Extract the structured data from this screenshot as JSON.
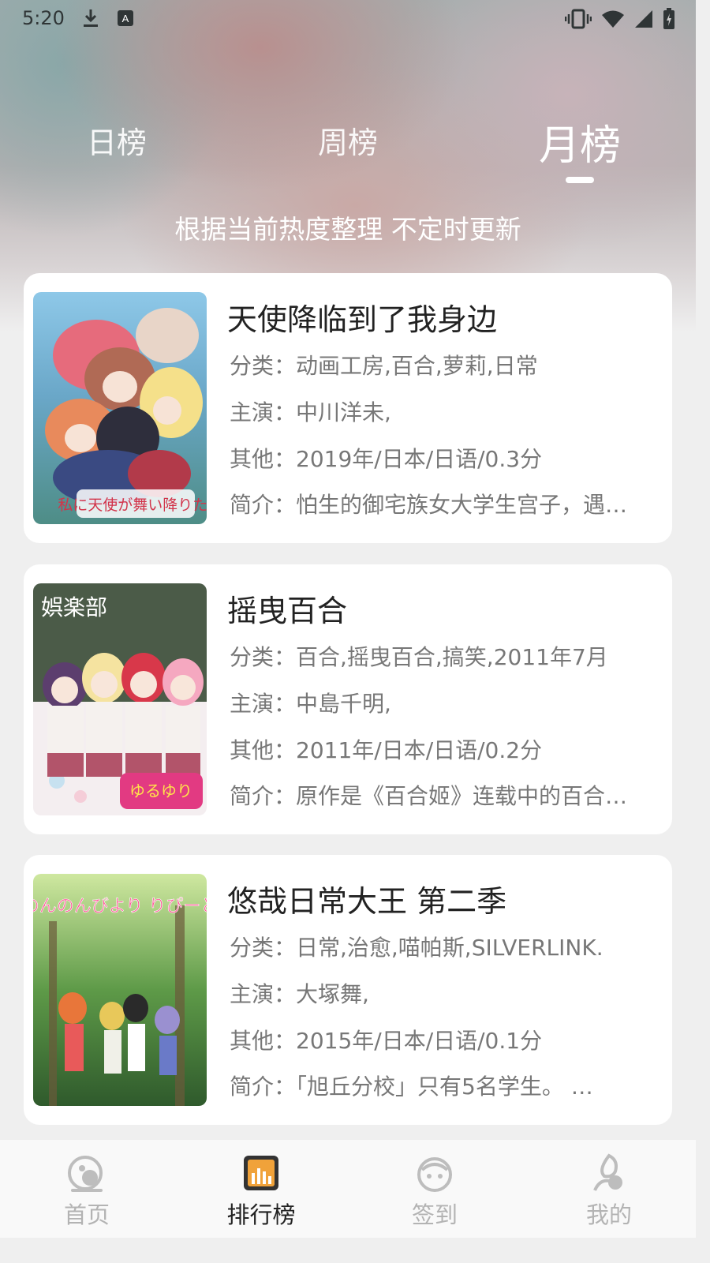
{
  "status_bar": {
    "time": "5:20",
    "icons": [
      "download-icon",
      "a-notification-icon",
      "vibrate-icon",
      "wifi-icon",
      "signal-icon",
      "battery-icon"
    ]
  },
  "tabs": {
    "daily": "日榜",
    "weekly": "周榜",
    "monthly": "月榜",
    "active": "monthly"
  },
  "subtitle": "根据当前热度整理 不定时更新",
  "items": [
    {
      "title": "天使降临到了我身边",
      "category": "分类：动画工房,百合,萝莉,日常",
      "cast": "主演：中川洋未,",
      "other": "其他：2019年/日本/日语/0.3分",
      "intro": "简介：怕生的御宅族女大学生宫子，遇…",
      "poster_text": "私に天使が舞い降りた!"
    },
    {
      "title": "摇曳百合",
      "category": "分类：百合,摇曳百合,搞笑,2011年7月",
      "cast": "主演：中島千明,",
      "other": "其他：2011年/日本/日语/0.2分",
      "intro": "简介：原作是《百合姬》连载中的百合…",
      "poster_text": "娯楽部"
    },
    {
      "title": "悠哉日常大王 第二季",
      "category": "分类：日常,治愈,喵帕斯,SILVERLINK.",
      "cast": "主演：大塚舞,",
      "other": "其他：2015年/日本/日语/0.1分",
      "intro": "简介：「旭丘分校」只有5名学生。 …",
      "poster_text": "のんのんびより りぴーと"
    }
  ],
  "bottom_nav": [
    {
      "label": "首页",
      "icon": "home-icon"
    },
    {
      "label": "排行榜",
      "icon": "ranking-icon"
    },
    {
      "label": "签到",
      "icon": "checkin-icon"
    },
    {
      "label": "我的",
      "icon": "profile-icon"
    }
  ],
  "colors": {
    "accent": "#f0a23a",
    "active_text": "#222222",
    "inactive_text": "#b3b3b3"
  }
}
